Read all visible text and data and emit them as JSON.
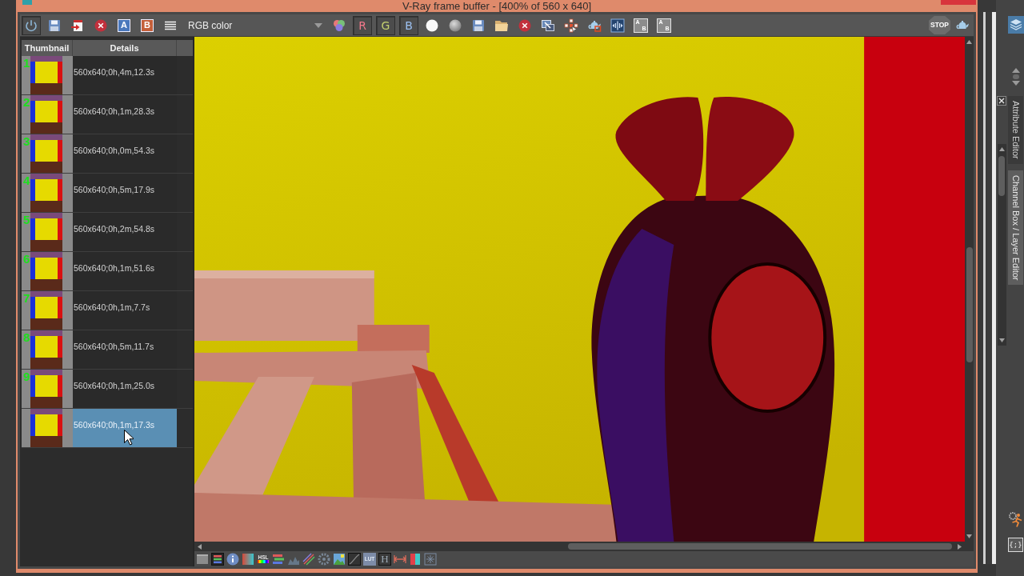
{
  "window": {
    "title": "V-Ray frame buffer - [400% of 560 x 640]"
  },
  "toolbar": {
    "power_button": {
      "on": true
    },
    "history_buttons": [
      "A",
      "B"
    ],
    "channel_select": {
      "value": "RGB color"
    },
    "channel_toggles": [
      {
        "label": "R",
        "on": true
      },
      {
        "label": "G",
        "on": true
      },
      {
        "label": "B",
        "on": true
      }
    ],
    "compare_buttons": [
      [
        "A",
        "B"
      ],
      [
        "A",
        "B"
      ]
    ],
    "stop_button": "STOP"
  },
  "history": {
    "columns": [
      "Thumbnail",
      "Details"
    ],
    "items": [
      {
        "number": "1",
        "details": "560x640;0h,4m,12.3s",
        "selected": false
      },
      {
        "number": "2",
        "details": "560x640;0h,1m,28.3s",
        "selected": false
      },
      {
        "number": "3",
        "details": "560x640;0h,0m,54.3s",
        "selected": false
      },
      {
        "number": "4",
        "details": "560x640;0h,5m,17.9s",
        "selected": false
      },
      {
        "number": "5",
        "details": "560x640;0h,2m,54.8s",
        "selected": false
      },
      {
        "number": "6",
        "details": "560x640;0h,1m,51.6s",
        "selected": false
      },
      {
        "number": "7",
        "details": "560x640;0h,1m,7.7s",
        "selected": false
      },
      {
        "number": "8",
        "details": "560x640;0h,5m,11.7s",
        "selected": false
      },
      {
        "number": "9",
        "details": "560x640;0h,1m,25.0s",
        "selected": false
      },
      {
        "details": "560x640;0h,1m,17.3s",
        "selected": true
      }
    ]
  },
  "bottom_toolbar": {
    "hsl_button": "HSL",
    "lut_button": "LUT",
    "levels_button": "H"
  },
  "side_panel": {
    "tabs": [
      {
        "label": "Attribute Editor",
        "selected": false
      },
      {
        "label": "Channel Box / Layer Editor",
        "selected": true
      }
    ],
    "script_editor_button": "{;}"
  }
}
